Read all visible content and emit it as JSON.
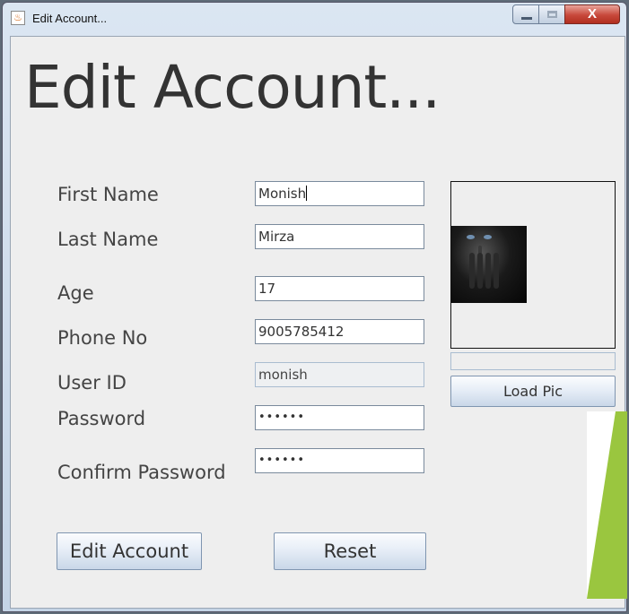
{
  "window": {
    "title": "Edit Account...",
    "close_glyph": "X",
    "title_icon": "java-cup-icon"
  },
  "form": {
    "heading": "Edit Account...",
    "labels": {
      "first_name": "First Name",
      "last_name": "Last Name",
      "age": "Age",
      "phone": "Phone No",
      "user_id": "User ID",
      "password": "Password",
      "confirm_password": "Confirm Password"
    },
    "values": {
      "first_name": "Monish",
      "last_name": "Mirza",
      "age": "17",
      "phone": "9005785412",
      "user_id": "monish",
      "password": "••••••",
      "confirm_password": "••••••"
    },
    "buttons": {
      "edit_account": "Edit Account",
      "reset": "Reset",
      "load_pic": "Load Pic"
    }
  },
  "colors": {
    "accent_green": "#9ac63f",
    "close_red": "#c7483a"
  }
}
